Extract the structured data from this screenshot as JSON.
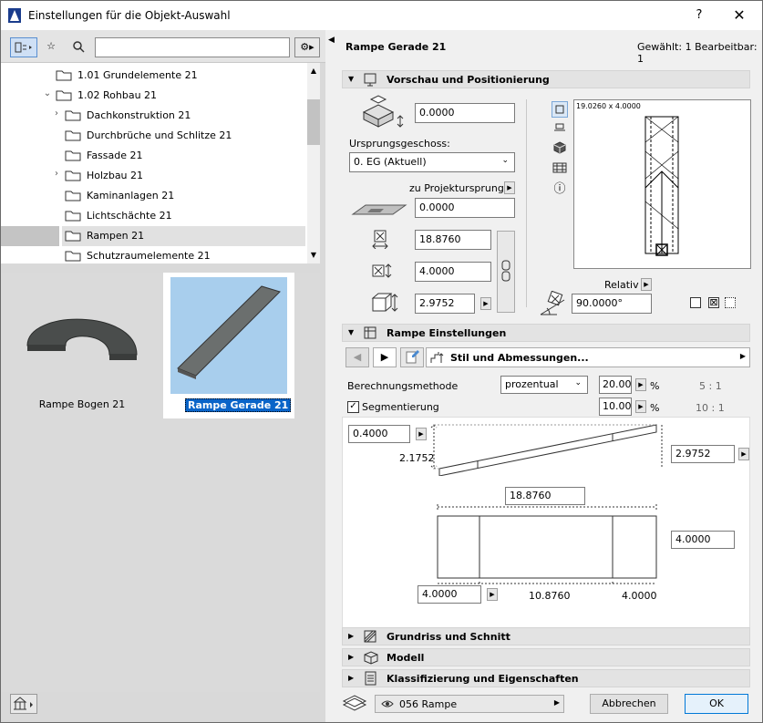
{
  "window": {
    "title": "Einstellungen für die Objekt-Auswahl",
    "help": "?",
    "close": "✕"
  },
  "library": {
    "tree": [
      {
        "label": "1.01 Grundelemente 21",
        "indent": 1,
        "caret": ""
      },
      {
        "label": "1.02 Rohbau 21",
        "indent": 1,
        "caret": "⌄"
      },
      {
        "label": "Dachkonstruktion 21",
        "indent": 2,
        "caret": "›"
      },
      {
        "label": "Durchbrüche und Schlitze 21",
        "indent": 2,
        "caret": ""
      },
      {
        "label": "Fassade 21",
        "indent": 2,
        "caret": ""
      },
      {
        "label": "Holzbau 21",
        "indent": 2,
        "caret": "›"
      },
      {
        "label": "Kaminanlagen 21",
        "indent": 2,
        "caret": ""
      },
      {
        "label": "Lichtschächte 21",
        "indent": 2,
        "caret": ""
      },
      {
        "label": "Rampen 21",
        "indent": 2,
        "caret": "",
        "selected": true
      },
      {
        "label": "Schutzraumelemente 21",
        "indent": 2,
        "caret": ""
      }
    ],
    "items": [
      {
        "label": "Rampe Bogen 21"
      },
      {
        "label": "Rampe Gerade 21",
        "selected": true
      }
    ]
  },
  "header": {
    "object_name": "Rampe Gerade 21",
    "selection_info": "Gewählt: 1 Bearbeitbar: 1"
  },
  "sections": {
    "vorschau": "Vorschau und Positionierung",
    "einstellungen": "Rampe Einstellungen",
    "grundriss": "Grundriss und Schnitt",
    "modell": "Modell",
    "klassifizierung": "Klassifizierung und Eigenschaften"
  },
  "position": {
    "elevation": "0.0000",
    "ursprungsgeschoss_label": "Ursprungsgeschoss:",
    "geschoss": "0. EG (Aktuell)",
    "projekt_label": "zu Projektursprung",
    "projekt_value": "0.0000",
    "length": "18.8760",
    "width": "4.0000",
    "height": "2.9752",
    "preview_dims": "19.0260 x 4.0000",
    "relativ": "Relativ",
    "angle": "90.0000°"
  },
  "einstellungen": {
    "stil": "Stil und Abmessungen...",
    "methode_label": "Berechnungsmethode",
    "methode": "prozentual",
    "methode_value": "20.000",
    "methode_unit": "%",
    "methode_ratio": "5 : 1",
    "segment_label": "Segmentierung",
    "segment_checked": true,
    "segment_value": "10.000",
    "segment_unit": "%",
    "segment_ratio": "10 : 1",
    "dim_left_top": "0.4000",
    "dim_left_mid": "2.1752",
    "dim_right": "2.9752",
    "dim_total": "18.8760",
    "dim_width": "4.0000",
    "dim_start": "4.0000",
    "dim_mid": "10.8760",
    "dim_end": "4.0000"
  },
  "footer": {
    "layer": "056 Rampe",
    "cancel": "Abbrechen",
    "ok": "OK"
  }
}
